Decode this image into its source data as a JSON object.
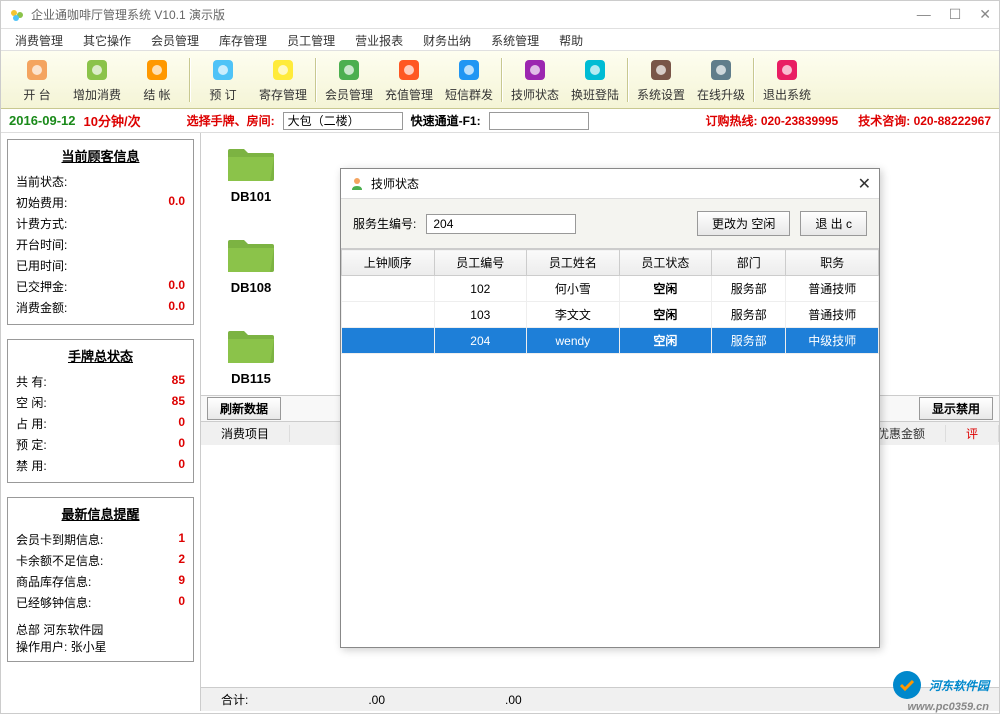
{
  "window": {
    "title": "企业通咖啡厅管理系统 V10.1  演示版"
  },
  "menu": [
    "消费管理",
    "其它操作",
    "会员管理",
    "库存管理",
    "员工管理",
    "营业报表",
    "财务出纳",
    "系统管理",
    "帮助"
  ],
  "toolbar": [
    {
      "label": "开 台"
    },
    {
      "label": "增加消费"
    },
    {
      "label": "结 帐"
    },
    {
      "label": "预 订"
    },
    {
      "label": "寄存管理"
    },
    {
      "label": "会员管理"
    },
    {
      "label": "充值管理"
    },
    {
      "label": "短信群发"
    },
    {
      "label": "技师状态"
    },
    {
      "label": "换班登陆"
    },
    {
      "label": "系统设置"
    },
    {
      "label": "在线升级"
    },
    {
      "label": "退出系统"
    }
  ],
  "filter": {
    "date": "2016-09-12",
    "freq": "10分钟/次",
    "select_label": "选择手牌、房间:",
    "room_value": "大包（二楼）",
    "quick_label": "快速通道-F1:",
    "quick_value": "",
    "hotline_label": "订购热线:",
    "hotline_num": "020-23839995",
    "tech_label": "技术咨询:",
    "tech_num": "020-88222967"
  },
  "customer_box": {
    "title": "当前顾客信息",
    "rows": [
      {
        "k": "当前状态:",
        "v": ""
      },
      {
        "k": "初始费用:",
        "v": "0.0",
        "red": true
      },
      {
        "k": "计费方式:",
        "v": ""
      },
      {
        "k": "开台时间:",
        "v": ""
      },
      {
        "k": "已用时间:",
        "v": ""
      },
      {
        "k": "已交押金:",
        "v": "0.0",
        "red": true
      },
      {
        "k": "消费金额:",
        "v": "0.0",
        "red": true
      }
    ]
  },
  "status_box": {
    "title": "手牌总状态",
    "rows": [
      {
        "k": "共    有:",
        "v": "85",
        "red": true
      },
      {
        "k": "空    闲:",
        "v": "85",
        "red": true
      },
      {
        "k": "占    用:",
        "v": "0",
        "red": true
      },
      {
        "k": "预    定:",
        "v": "0",
        "red": true
      },
      {
        "k": "禁    用:",
        "v": "0",
        "red": true
      }
    ]
  },
  "alert_box": {
    "title": "最新信息提醒",
    "rows": [
      {
        "k": "会员卡到期信息:",
        "v": "1",
        "red": true
      },
      {
        "k": "卡余额不足信息:",
        "v": "2",
        "red": true
      },
      {
        "k": "商品库存信息:",
        "v": "9",
        "red": true
      },
      {
        "k": "已经够钟信息:",
        "v": "0",
        "red": true
      }
    ],
    "footer1": "总部  河东软件园",
    "footer2": "操作用户: 张小星"
  },
  "rooms": [
    "DB101",
    "DB108",
    "DB115"
  ],
  "bottom": {
    "refresh": "刷新数据",
    "showban": "显示禁用",
    "col1": "消费项目",
    "col2": "优惠金额",
    "col3": "评",
    "total_label": "合计:",
    "total_v1": ".00",
    "total_v2": ".00"
  },
  "dialog": {
    "title": "技师状态",
    "field_label": "服务生编号:",
    "field_value": "204",
    "btn_change": "更改为 空闲",
    "btn_exit": "退 出 c",
    "columns": [
      "上钟顺序",
      "员工编号",
      "员工姓名",
      "员工状态",
      "部门",
      "职务"
    ],
    "rows": [
      {
        "seq": "",
        "id": "102",
        "name": "何小雪",
        "status": "空闲",
        "dept": "服务部",
        "role": "普通技师",
        "sel": false
      },
      {
        "seq": "",
        "id": "103",
        "name": "李文文",
        "status": "空闲",
        "dept": "服务部",
        "role": "普通技师",
        "sel": false
      },
      {
        "seq": "",
        "id": "204",
        "name": "wendy",
        "status": "空闲",
        "dept": "服务部",
        "role": "中级技师",
        "sel": true
      }
    ]
  },
  "watermark": {
    "text": "河东软件园",
    "url": "www.pc0359.cn"
  }
}
